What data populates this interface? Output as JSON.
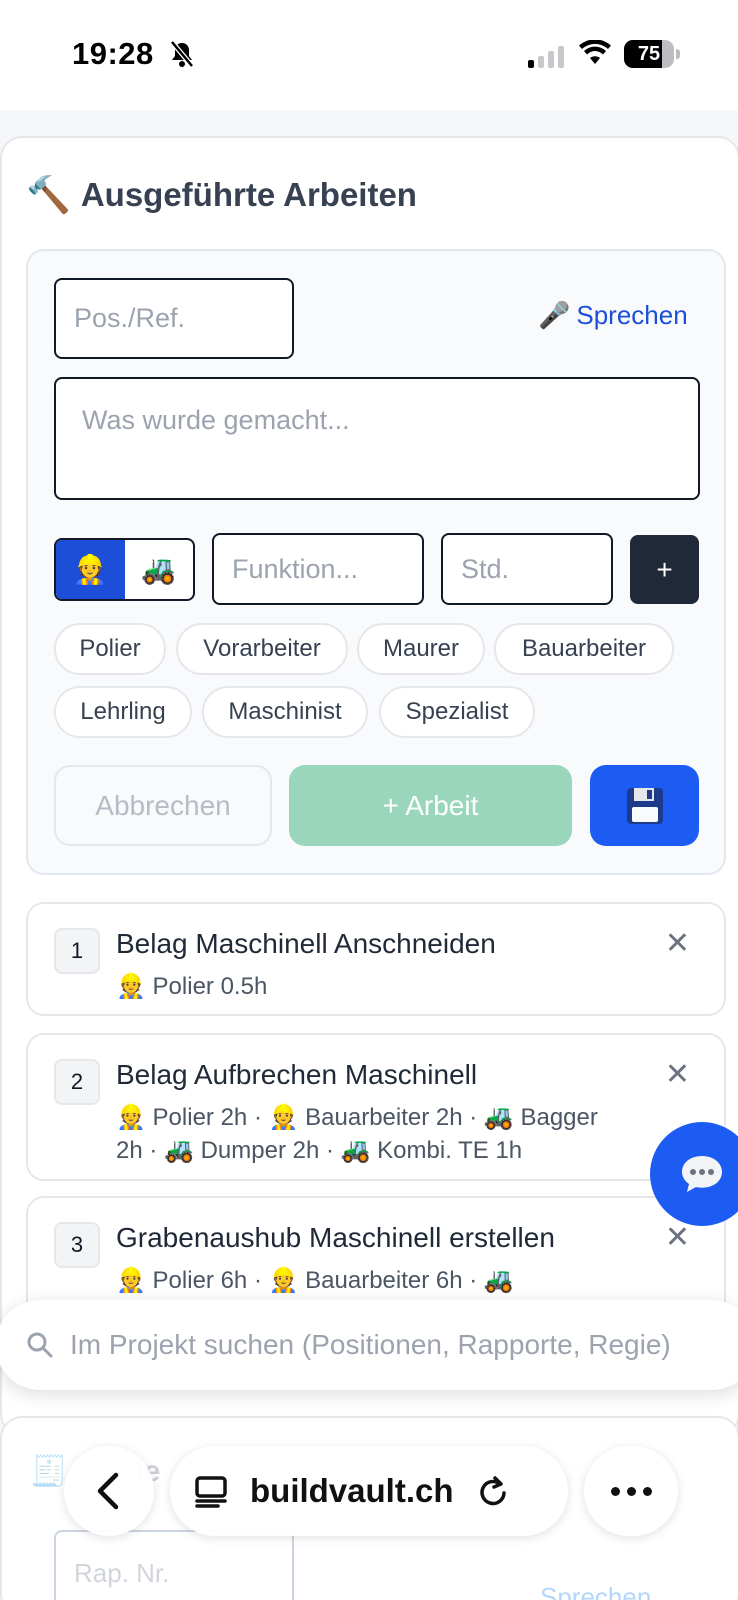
{
  "status_bar": {
    "time": "19:28",
    "battery": "75",
    "battery_level": 0.75
  },
  "section": {
    "title": "Ausgeführte Arbeiten",
    "icon": "hammer-icon"
  },
  "form": {
    "pos_placeholder": "Pos./Ref.",
    "speak_label": "Sprechen",
    "description_placeholder": "Was wurde gemacht...",
    "function_placeholder": "Funktion...",
    "hours_placeholder": "Std.",
    "add_label": "+",
    "toggle": {
      "active": "worker",
      "options": [
        "worker-icon",
        "tractor-icon"
      ]
    },
    "chips": [
      "Polier",
      "Vorarbeiter",
      "Maurer",
      "Bauarbeiter",
      "Lehrling",
      "Maschinist",
      "Spezialist"
    ],
    "cancel_label": "Abbrechen",
    "add_work_label": "+ Arbeit"
  },
  "items": [
    {
      "num": "1",
      "title": "Belag Maschinell Anschneiden",
      "meta_line1": "👷 Polier 0.5h",
      "meta_line2": ""
    },
    {
      "num": "2",
      "title": "Belag Aufbrechen Maschinell",
      "meta_line1": "👷 Polier 2h · 👷 Bauarbeiter 2h · 🚜 Bagger",
      "meta_line2": "2h · 🚜 Dumper 2h · 🚜 Kombi. TE 1h"
    },
    {
      "num": "3",
      "title": "Grabenaushub Maschinell erstellen",
      "meta_line1": "👷 Polier 6h · 👷 Bauarbeiter 6h · 🚜",
      "meta_line2": ""
    }
  ],
  "search": {
    "placeholder": "Im Projekt suchen (Positionen, Rapporte, Regie)"
  },
  "next_section": {
    "title_fragment": "ie",
    "pos_placeholder": "Rap. Nr.",
    "speak_label": "Sprechen"
  },
  "browser": {
    "url": "buildvault.ch"
  }
}
